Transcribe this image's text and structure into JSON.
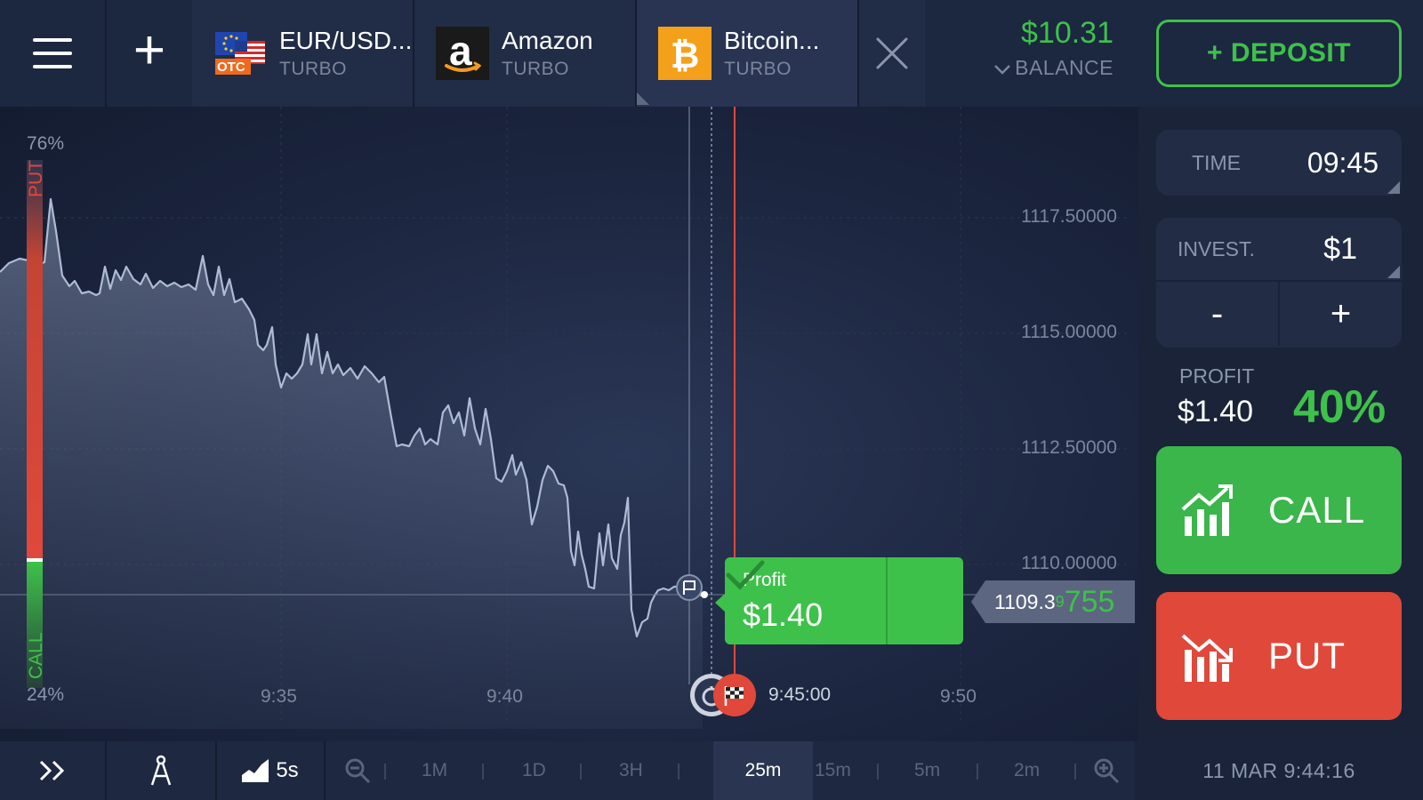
{
  "tabs": [
    {
      "name": "EUR/USD...",
      "type": "TURBO",
      "badge": "OTC"
    },
    {
      "name": "Amazon",
      "type": "TURBO",
      "letter": "a"
    },
    {
      "name": "Bitcoin...",
      "type": "TURBO"
    }
  ],
  "balance": {
    "amount": "$10.31",
    "label": "BALANCE"
  },
  "deposit_label": "+ DEPOSIT",
  "sentiment": {
    "put_pct": "76%",
    "call_pct": "24%",
    "put_label": "PUT",
    "call_label": "CALL",
    "call_fraction": 0.24
  },
  "chart": {
    "price_labels": [
      "1117.50000",
      "1115.00000",
      "1112.50000",
      "1110.00000"
    ],
    "time_labels": [
      "9:35",
      "9:40",
      "9:45:00",
      "9:50"
    ],
    "current_price": {
      "main": "1109.3",
      "small": "9",
      "big": "755"
    },
    "profit_popup": {
      "title": "Profit",
      "value": "$1.40"
    }
  },
  "panel": {
    "time_label": "TIME",
    "time_value": "09:45",
    "invest_label": "INVEST.",
    "invest_value": "$1",
    "minus": "-",
    "plus": "+",
    "profit_label": "PROFIT",
    "profit_amount": "$1.40",
    "profit_pct": "40%",
    "call_label": "CALL",
    "put_label": "PUT"
  },
  "bottom": {
    "candle_interval": "5s",
    "timeframes": [
      "1M",
      "1D",
      "3H",
      "25m",
      "15m",
      "5m",
      "2m"
    ],
    "selected_timeframe": "25m",
    "datetime": "11 MAR 9:44:16"
  },
  "colors": {
    "green": "#3ec14a",
    "red": "#e0483a",
    "bg": "#1a2338"
  }
}
